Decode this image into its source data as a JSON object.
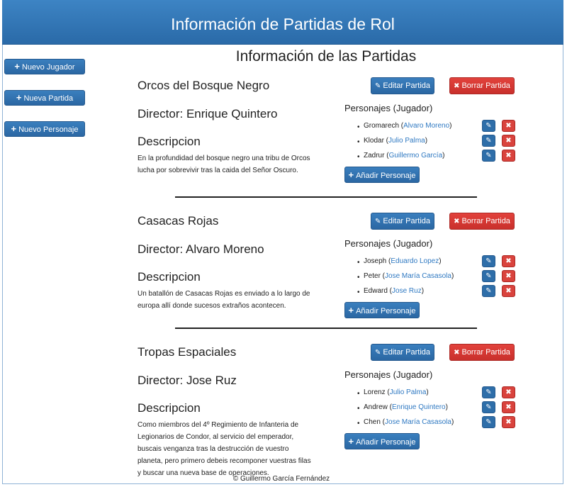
{
  "header": {
    "title": "Información de Partidas de Rol"
  },
  "sidebar": {
    "buttons": [
      {
        "label": "Nuevo Jugador"
      },
      {
        "label": "Nueva Partida"
      },
      {
        "label": "Nuevo Personaje"
      }
    ]
  },
  "main": {
    "title": "Información de las Partidas",
    "edit_label": "Editar Partida",
    "delete_label": "Borrar Partida",
    "characters_heading": "Personajes (Jugador)",
    "add_character_label": "Añadir Personaje",
    "description_heading": "Descripcion",
    "games": [
      {
        "name": "Orcos del Bosque Negro",
        "director": "Director: Enrique Quintero",
        "description": "En la profundidad del bosque negro una tribu de Orcos lucha por sobrevivir tras la caida del Señor Oscuro.",
        "characters": [
          {
            "name": "Gromarech",
            "player": "Alvaro Moreno"
          },
          {
            "name": "Klodar",
            "player": "Julio Palma"
          },
          {
            "name": "Zadrur",
            "player": "Guillermo García"
          }
        ]
      },
      {
        "name": "Casacas Rojas",
        "director": "Director: Alvaro Moreno",
        "description": "Un batallón de Casacas Rojas es enviado a lo largo de europa allí donde sucesos extraños acontecen.",
        "characters": [
          {
            "name": "Joseph",
            "player": "Eduardo Lopez"
          },
          {
            "name": "Peter",
            "player": "Jose María Casasola"
          },
          {
            "name": "Edward",
            "player": "Jose Ruz"
          }
        ]
      },
      {
        "name": "Tropas Espaciales",
        "director": "Director: Jose Ruz",
        "description": "Como miembros del 4º Regimiento de Infanteria de Legionarios de Condor, al servicio del emperador, buscais venganza tras la destrucción de vuestro planeta, pero primero debeis recomponer vuestras filas y buscar una nueva base de operaciones.",
        "characters": [
          {
            "name": "Lorenz",
            "player": "Julio Palma"
          },
          {
            "name": "Andrew",
            "player": "Enrique Quintero"
          },
          {
            "name": "Chen",
            "player": "Jose María Casasola"
          }
        ]
      }
    ]
  },
  "footer": {
    "text": "© Guillermo García Fernández"
  }
}
